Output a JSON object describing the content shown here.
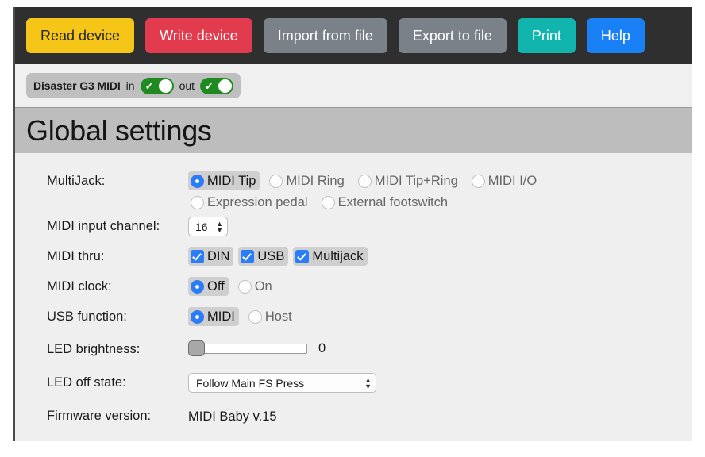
{
  "toolbar": {
    "buttons": [
      {
        "label": "Read device",
        "name": "read-device-button",
        "style": "read"
      },
      {
        "label": "Write device",
        "name": "write-device-button",
        "style": "write"
      },
      {
        "label": "Import from file",
        "name": "import-from-file-button",
        "style": "grey"
      },
      {
        "label": "Export to file",
        "name": "export-to-file-button",
        "style": "grey"
      },
      {
        "label": "Print",
        "name": "print-button",
        "style": "print"
      },
      {
        "label": "Help",
        "name": "help-button",
        "style": "help"
      }
    ],
    "colors": {
      "read": "#f5c518",
      "write": "#e13b4d",
      "grey": "#7b8189",
      "print": "#12b5ad",
      "help": "#1a80f5",
      "bar": "#2f2f2f"
    }
  },
  "device_status": {
    "device_name": "Disaster G3 MIDI",
    "in_label": "in",
    "out_label": "out",
    "in_enabled": true,
    "out_enabled": true,
    "toggle_on_color": "#1f8a1f"
  },
  "page": {
    "title": "Global settings"
  },
  "settings": {
    "multijack": {
      "label": "MultiJack:",
      "selected": "MIDI Tip",
      "options": [
        "MIDI Tip",
        "MIDI Ring",
        "MIDI Tip+Ring",
        "MIDI I/O",
        "Expression pedal",
        "External footswitch"
      ]
    },
    "midi_input_channel": {
      "label": "MIDI input channel:",
      "value": "16"
    },
    "midi_thru": {
      "label": "MIDI thru:",
      "options": [
        {
          "label": "DIN",
          "checked": true
        },
        {
          "label": "USB",
          "checked": true
        },
        {
          "label": "Multijack",
          "checked": true
        }
      ]
    },
    "midi_clock": {
      "label": "MIDI clock:",
      "selected": "Off",
      "options": [
        "Off",
        "On"
      ]
    },
    "usb_function": {
      "label": "USB function:",
      "selected": "MIDI",
      "options": [
        "MIDI",
        "Host"
      ]
    },
    "led_brightness": {
      "label": "LED brightness:",
      "value": "0",
      "min": 0,
      "max": 100,
      "percent": 0
    },
    "led_off_state": {
      "label": "LED off state:",
      "value": "Follow Main FS Press"
    },
    "firmware_version": {
      "label": "Firmware version:",
      "value": "MIDI Baby v.15"
    }
  }
}
